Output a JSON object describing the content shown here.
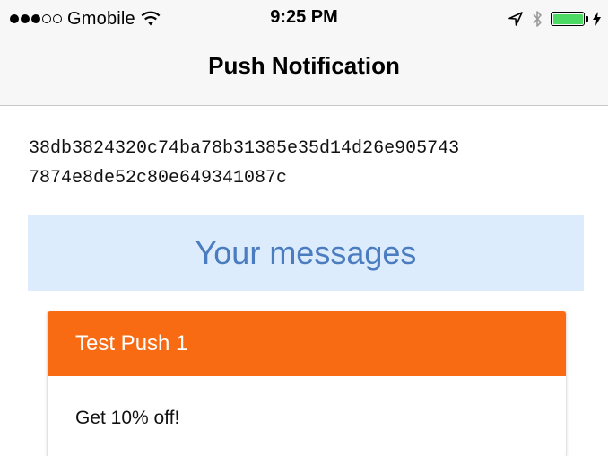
{
  "status_bar": {
    "carrier": "Gmobile",
    "time": "9:25 PM",
    "signal_bars_filled": 3,
    "signal_bars_total": 5,
    "icons": [
      "signal-dots-icon",
      "wifi-icon",
      "location-arrow-icon",
      "bluetooth-icon",
      "battery-icon",
      "charging-bolt-icon"
    ],
    "battery_level": 1.0,
    "battery_color": "#4cd964"
  },
  "nav": {
    "title": "Push Notification"
  },
  "device_token": {
    "line1": "38db3824320c74ba78b31385e35d14d26e905743",
    "line2": "7874e8de52c80e649341087c"
  },
  "messages_section": {
    "title": "Your messages",
    "background_color": "#dcecfc",
    "text_color": "#4a7cbf"
  },
  "messages": [
    {
      "title": "Test Push 1",
      "body": "Get 10% off!",
      "header_color": "#f96b13"
    }
  ]
}
